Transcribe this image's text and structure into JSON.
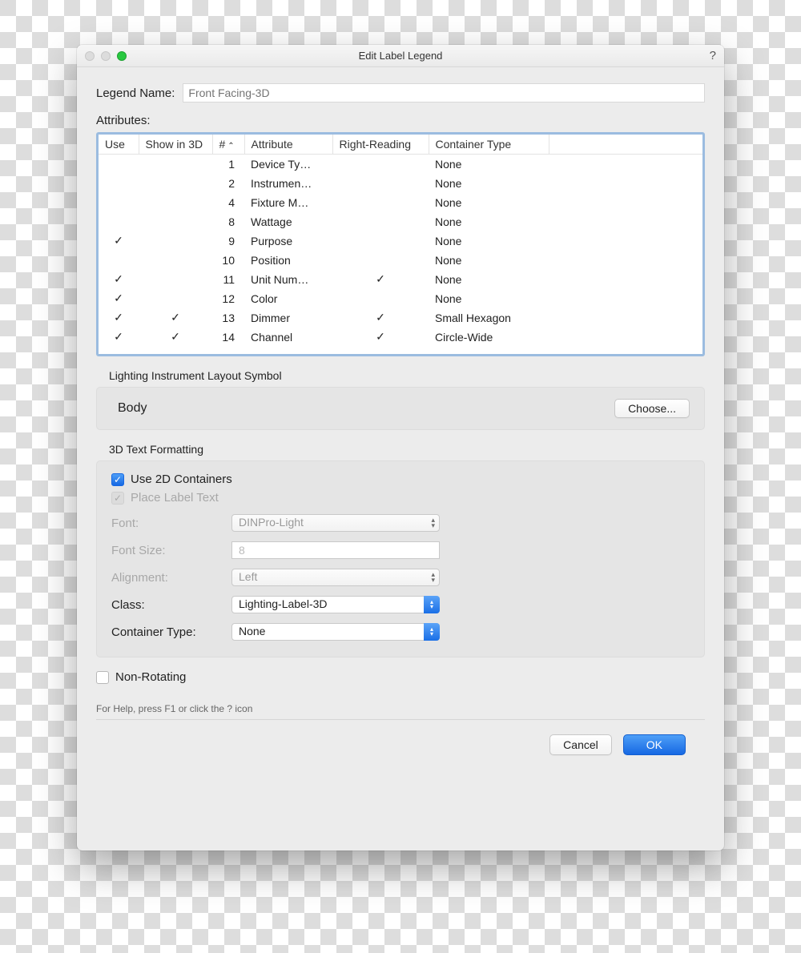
{
  "window": {
    "title": "Edit Label Legend",
    "help": "?"
  },
  "legend_name": {
    "label": "Legend Name:",
    "placeholder": "Front Facing-3D"
  },
  "attributes_label": "Attributes:",
  "columns": {
    "use": "Use",
    "show3d": "Show in 3D",
    "num": "#",
    "attr": "Attribute",
    "rr": "Right-Reading",
    "ct": "Container Type"
  },
  "rows": [
    {
      "use": false,
      "show3d": false,
      "num": "1",
      "attr": "Device Ty…",
      "rr": false,
      "ct": "None"
    },
    {
      "use": false,
      "show3d": false,
      "num": "2",
      "attr": "Instrumen…",
      "rr": false,
      "ct": "None"
    },
    {
      "use": false,
      "show3d": false,
      "num": "4",
      "attr": "Fixture M…",
      "rr": false,
      "ct": "None"
    },
    {
      "use": false,
      "show3d": false,
      "num": "8",
      "attr": "Wattage",
      "rr": false,
      "ct": "None"
    },
    {
      "use": true,
      "show3d": false,
      "num": "9",
      "attr": "Purpose",
      "rr": false,
      "ct": "None"
    },
    {
      "use": false,
      "show3d": false,
      "num": "10",
      "attr": "Position",
      "rr": false,
      "ct": "None"
    },
    {
      "use": true,
      "show3d": false,
      "num": "11",
      "attr": "Unit Num…",
      "rr": true,
      "ct": "None"
    },
    {
      "use": true,
      "show3d": false,
      "num": "12",
      "attr": "Color",
      "rr": false,
      "ct": "None"
    },
    {
      "use": true,
      "show3d": true,
      "num": "13",
      "attr": "Dimmer",
      "rr": true,
      "ct": "Small Hexagon"
    },
    {
      "use": true,
      "show3d": true,
      "num": "14",
      "attr": "Channel",
      "rr": true,
      "ct": "Circle-Wide"
    }
  ],
  "symbol": {
    "title": "Lighting Instrument Layout Symbol",
    "body": "Body",
    "choose": "Choose..."
  },
  "tdf": {
    "title": "3D Text Formatting",
    "use2d": "Use 2D Containers",
    "place": "Place Label Text",
    "font_label": "Font:",
    "font_val": "DINPro-Light",
    "size_label": "Font Size:",
    "size_val": "8",
    "align_label": "Alignment:",
    "align_val": "Left",
    "class_label": "Class:",
    "class_val": "Lighting-Label-3D",
    "ct_label": "Container Type:",
    "ct_val": "None"
  },
  "nonrot": "Non-Rotating",
  "help_text": "For Help, press F1 or click the ? icon",
  "buttons": {
    "cancel": "Cancel",
    "ok": "OK"
  }
}
